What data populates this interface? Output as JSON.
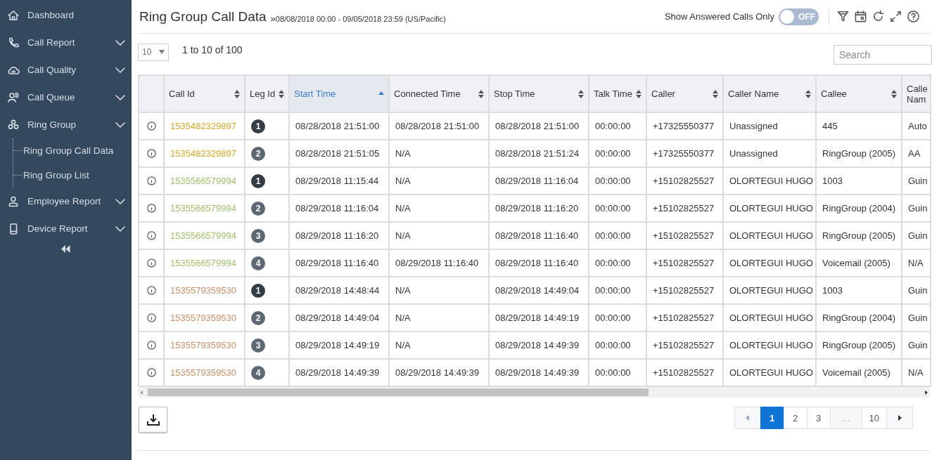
{
  "sidebar": {
    "items": [
      {
        "label": "Dashboard",
        "expandable": false
      },
      {
        "label": "Call Report",
        "expandable": true
      },
      {
        "label": "Call Quality",
        "expandable": true
      },
      {
        "label": "Call Queue",
        "expandable": true
      },
      {
        "label": "Ring Group",
        "expandable": true,
        "children": [
          {
            "label": "Ring Group Call Data"
          },
          {
            "label": "Ring Group List"
          }
        ]
      },
      {
        "label": "Employee Report",
        "expandable": true
      },
      {
        "label": "Device Report",
        "expandable": true
      }
    ]
  },
  "header": {
    "title": "Ring Group Call Data",
    "range_marker": "»",
    "range": "08/08/2018 00:00 - 09/05/2018 23:59 (US/Pacific)",
    "toggle_label": "Show Answered Calls Only",
    "toggle": {
      "on": false,
      "text": "OFF"
    }
  },
  "controls": {
    "page_size": "10",
    "summary": "1 to 10 of 100",
    "search": {
      "placeholder": "Search"
    }
  },
  "table": {
    "columns": [
      {
        "label": "Call Id",
        "sortable": true,
        "selected": false
      },
      {
        "label": "Leg Id",
        "sortable": true,
        "selected": false
      },
      {
        "label": "Start Time",
        "sortable": true,
        "selected": true
      },
      {
        "label": "Connected Time",
        "sortable": true,
        "selected": false
      },
      {
        "label": "Stop Time",
        "sortable": true,
        "selected": false
      },
      {
        "label": "Talk Time",
        "sortable": true,
        "selected": false
      },
      {
        "label": "Caller",
        "sortable": true,
        "selected": false
      },
      {
        "label": "Caller Name",
        "sortable": true,
        "selected": false
      },
      {
        "label": "Callee",
        "sortable": true,
        "selected": false
      },
      {
        "label": "Calle Nam",
        "selected": false
      }
    ],
    "rows": [
      {
        "cells": [
          {
            "text": "1535482329897",
            "color": "#d4a72c"
          },
          {
            "text": "1",
            "color": "#343d46"
          },
          "08/28/2018 21:51:00",
          "08/28/2018 21:51:00",
          "08/28/2018 21:51:00",
          "00:00:00",
          "+17325550377",
          "Unassigned",
          "445",
          "Auto"
        ]
      },
      {
        "cells": [
          {
            "text": "1535482329897",
            "color": "#d4a72c"
          },
          {
            "text": "2",
            "color": "#5d6872"
          },
          "08/28/2018 21:51:05",
          "N/A",
          "08/28/2018 21:51:24",
          "00:00:00",
          "+17325550377",
          "Unassigned",
          "RingGroup (2005)",
          "AA"
        ]
      },
      {
        "cells": [
          {
            "text": "1535566579994",
            "color": "#9fbf6a"
          },
          {
            "text": "1",
            "color": "#343d46"
          },
          "08/29/2018 11:15:44",
          "N/A",
          "08/29/2018 11:16:04",
          "00:00:00",
          "+15102825527",
          "OLORTEGUI HUGO",
          "1003",
          "Guin"
        ]
      },
      {
        "cells": [
          {
            "text": "1535566579994",
            "color": "#9fbf6a"
          },
          {
            "text": "2",
            "color": "#5d6872"
          },
          "08/29/2018 11:16:04",
          "N/A",
          "08/29/2018 11:16:20",
          "00:00:00",
          "+15102825527",
          "OLORTEGUI HUGO",
          "RingGroup (2004)",
          "Guin"
        ]
      },
      {
        "cells": [
          {
            "text": "1535566579994",
            "color": "#9fbf6a"
          },
          {
            "text": "3",
            "color": "#5d6872"
          },
          "08/29/2018 11:16:20",
          "N/A",
          "08/29/2018 11:16:40",
          "00:00:00",
          "+15102825527",
          "OLORTEGUI HUGO",
          "RingGroup (2005)",
          "Guin"
        ]
      },
      {
        "cells": [
          {
            "text": "1535566579994",
            "color": "#9fbf6a"
          },
          {
            "text": "4",
            "color": "#5d6872"
          },
          "08/29/2018 11:16:40",
          "08/29/2018 11:16:40",
          "08/29/2018 11:16:40",
          "00:00:00",
          "+15102825527",
          "OLORTEGUI HUGO",
          "Voicemail (2005)",
          "N/A"
        ]
      },
      {
        "cells": [
          {
            "text": "1535579359530",
            "color": "#c8906a"
          },
          {
            "text": "1",
            "color": "#343d46"
          },
          "08/29/2018 14:48:44",
          "N/A",
          "08/29/2018 14:49:04",
          "00:00:00",
          "+15102825527",
          "OLORTEGUI HUGO",
          "1003",
          "Guin"
        ]
      },
      {
        "cells": [
          {
            "text": "1535579359530",
            "color": "#c8906a"
          },
          {
            "text": "2",
            "color": "#5d6872"
          },
          "08/29/2018 14:49:04",
          "N/A",
          "08/29/2018 14:49:19",
          "00:00:00",
          "+15102825527",
          "OLORTEGUI HUGO",
          "RingGroup (2004)",
          "Guin"
        ]
      },
      {
        "cells": [
          {
            "text": "1535579359530",
            "color": "#c8906a"
          },
          {
            "text": "3",
            "color": "#5d6872"
          },
          "08/29/2018 14:49:19",
          "N/A",
          "08/29/2018 14:49:39",
          "00:00:00",
          "+15102825527",
          "OLORTEGUI HUGO",
          "RingGroup (2005)",
          "Guin"
        ]
      },
      {
        "cells": [
          {
            "text": "1535579359530",
            "color": "#c8906a"
          },
          {
            "text": "4",
            "color": "#5d6872"
          },
          "08/29/2018 14:49:39",
          "08/29/2018 14:49:39",
          "08/29/2018 14:49:39",
          "00:00:00",
          "+15102825527",
          "OLORTEGUI HUGO",
          "Voicemail (2005)",
          "N/A"
        ]
      }
    ]
  },
  "pagination": {
    "pages": [
      {
        "label": "1",
        "selected": true,
        "disabled": false
      },
      {
        "label": "2",
        "selected": false,
        "disabled": false
      },
      {
        "label": "3",
        "selected": false,
        "disabled": false
      },
      {
        "label": "…",
        "selected": false,
        "disabled": true
      },
      {
        "label": "10",
        "selected": false,
        "disabled": false
      }
    ]
  }
}
